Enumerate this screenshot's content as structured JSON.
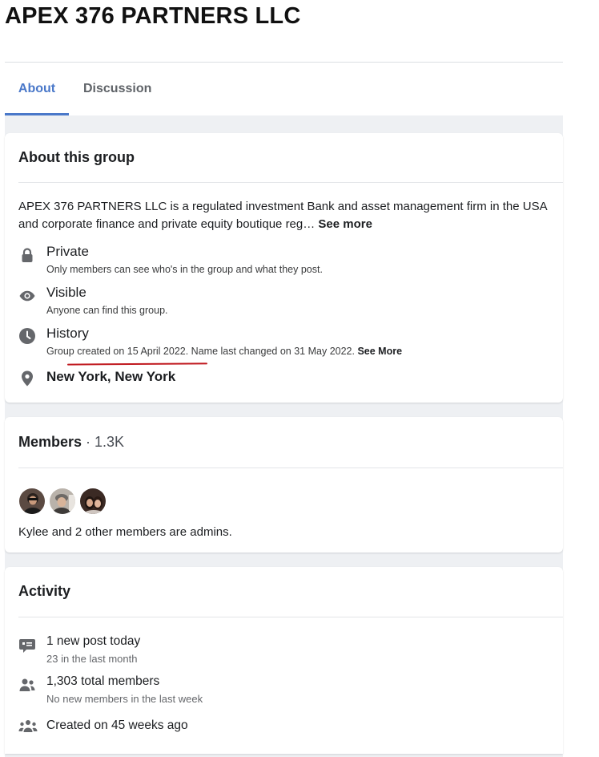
{
  "page": {
    "title": "APEX 376 PARTNERS LLC"
  },
  "tabs": [
    {
      "label": "About",
      "active": true
    },
    {
      "label": "Discussion",
      "active": false
    }
  ],
  "about": {
    "heading": "About this group",
    "description": "APEX 376 PARTNERS LLC is a regulated investment Bank and asset management firm in the USA and corporate finance and private equity boutique reg…",
    "see_more": "See more",
    "privacy": {
      "icon": "lock-icon",
      "title": "Private",
      "subtitle": "Only members can see who's in the group and what they post."
    },
    "visibility": {
      "icon": "eye-icon",
      "title": "Visible",
      "subtitle": "Anyone can find this group."
    },
    "history": {
      "icon": "clock-icon",
      "title": "History",
      "subtitle": "Group created on 15 April 2022. Name last changed on 31 May 2022.",
      "see_more": "See More"
    },
    "location": {
      "icon": "location-pin-icon",
      "title": "New York, New York"
    }
  },
  "members": {
    "heading": "Members",
    "count": " · 1.3K",
    "admins_text": "Kylee and 2 other members are admins."
  },
  "activity": {
    "heading": "Activity",
    "items": [
      {
        "icon": "post-icon",
        "title": "1 new post today",
        "subtitle": "23 in the last month"
      },
      {
        "icon": "members-icon",
        "title": "1,303 total members",
        "subtitle": "No new members in the last week"
      },
      {
        "icon": "group-icon",
        "title": "Created on 45 weeks ago",
        "subtitle": ""
      }
    ]
  },
  "colors": {
    "accent": "#4a78c9",
    "underline_mark": "#c0191f",
    "background": "#eef0f3"
  }
}
